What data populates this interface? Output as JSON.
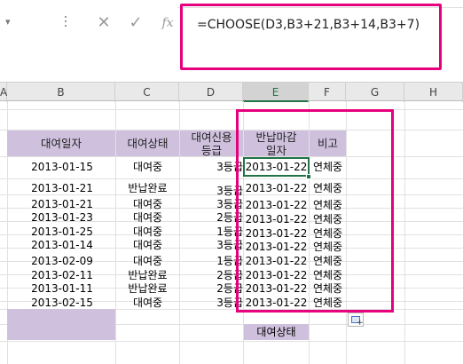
{
  "formula_bar": {
    "formula": "=CHOOSE(D3,B3+21,B3+14,B3+7)",
    "fx_label": "fx",
    "cancel_glyph": "✕",
    "enter_glyph": "✓"
  },
  "columns": [
    "A",
    "B",
    "C",
    "D",
    "E",
    "F",
    "G",
    "H"
  ],
  "table": {
    "headers": {
      "b": "대여일자",
      "c": "대여상태",
      "d_line1": "대여신용",
      "d_line2": "등급",
      "e_line1": "반납마감",
      "e_line2": "일자",
      "f": "비고"
    },
    "rows": [
      {
        "date": "2013-01-15",
        "status": "대여중",
        "grade": "3등급",
        "due": "2013-01-22",
        "note": "연체중"
      },
      {
        "date": "2013-01-21",
        "status": "반납완료",
        "grade": "3등급",
        "due": "2013-01-22",
        "note": "연체중"
      },
      {
        "date": "2013-01-21",
        "status": "대여중",
        "grade": "3등급",
        "due": "2013-01-22",
        "note": "연체중"
      },
      {
        "date": "2013-01-23",
        "status": "대여중",
        "grade": "2등급",
        "due": "2013-01-22",
        "note": "연체중"
      },
      {
        "date": "2013-01-25",
        "status": "대여중",
        "grade": "1등급",
        "due": "2013-01-22",
        "note": "연체중"
      },
      {
        "date": "2013-01-14",
        "status": "대여중",
        "grade": "3등급",
        "due": "2013-01-22",
        "note": "연체중"
      },
      {
        "date": "2013-02-09",
        "status": "대여중",
        "grade": "1등급",
        "due": "2013-01-22",
        "note": "연체중"
      },
      {
        "date": "2013-02-11",
        "status": "반납완료",
        "grade": "2등급",
        "due": "2013-01-22",
        "note": "연체중"
      },
      {
        "date": "2013-01-11",
        "status": "반납완료",
        "grade": "2등급",
        "due": "2013-01-22",
        "note": "연체중"
      },
      {
        "date": "2013-02-15",
        "status": "대여중",
        "grade": "3등급",
        "due": "2013-01-22",
        "note": "연체중"
      }
    ],
    "bottom_label": "대여상태"
  },
  "colors": {
    "header_fill": "#cfc1de",
    "highlight": "#e6007e",
    "selection": "#217346"
  }
}
